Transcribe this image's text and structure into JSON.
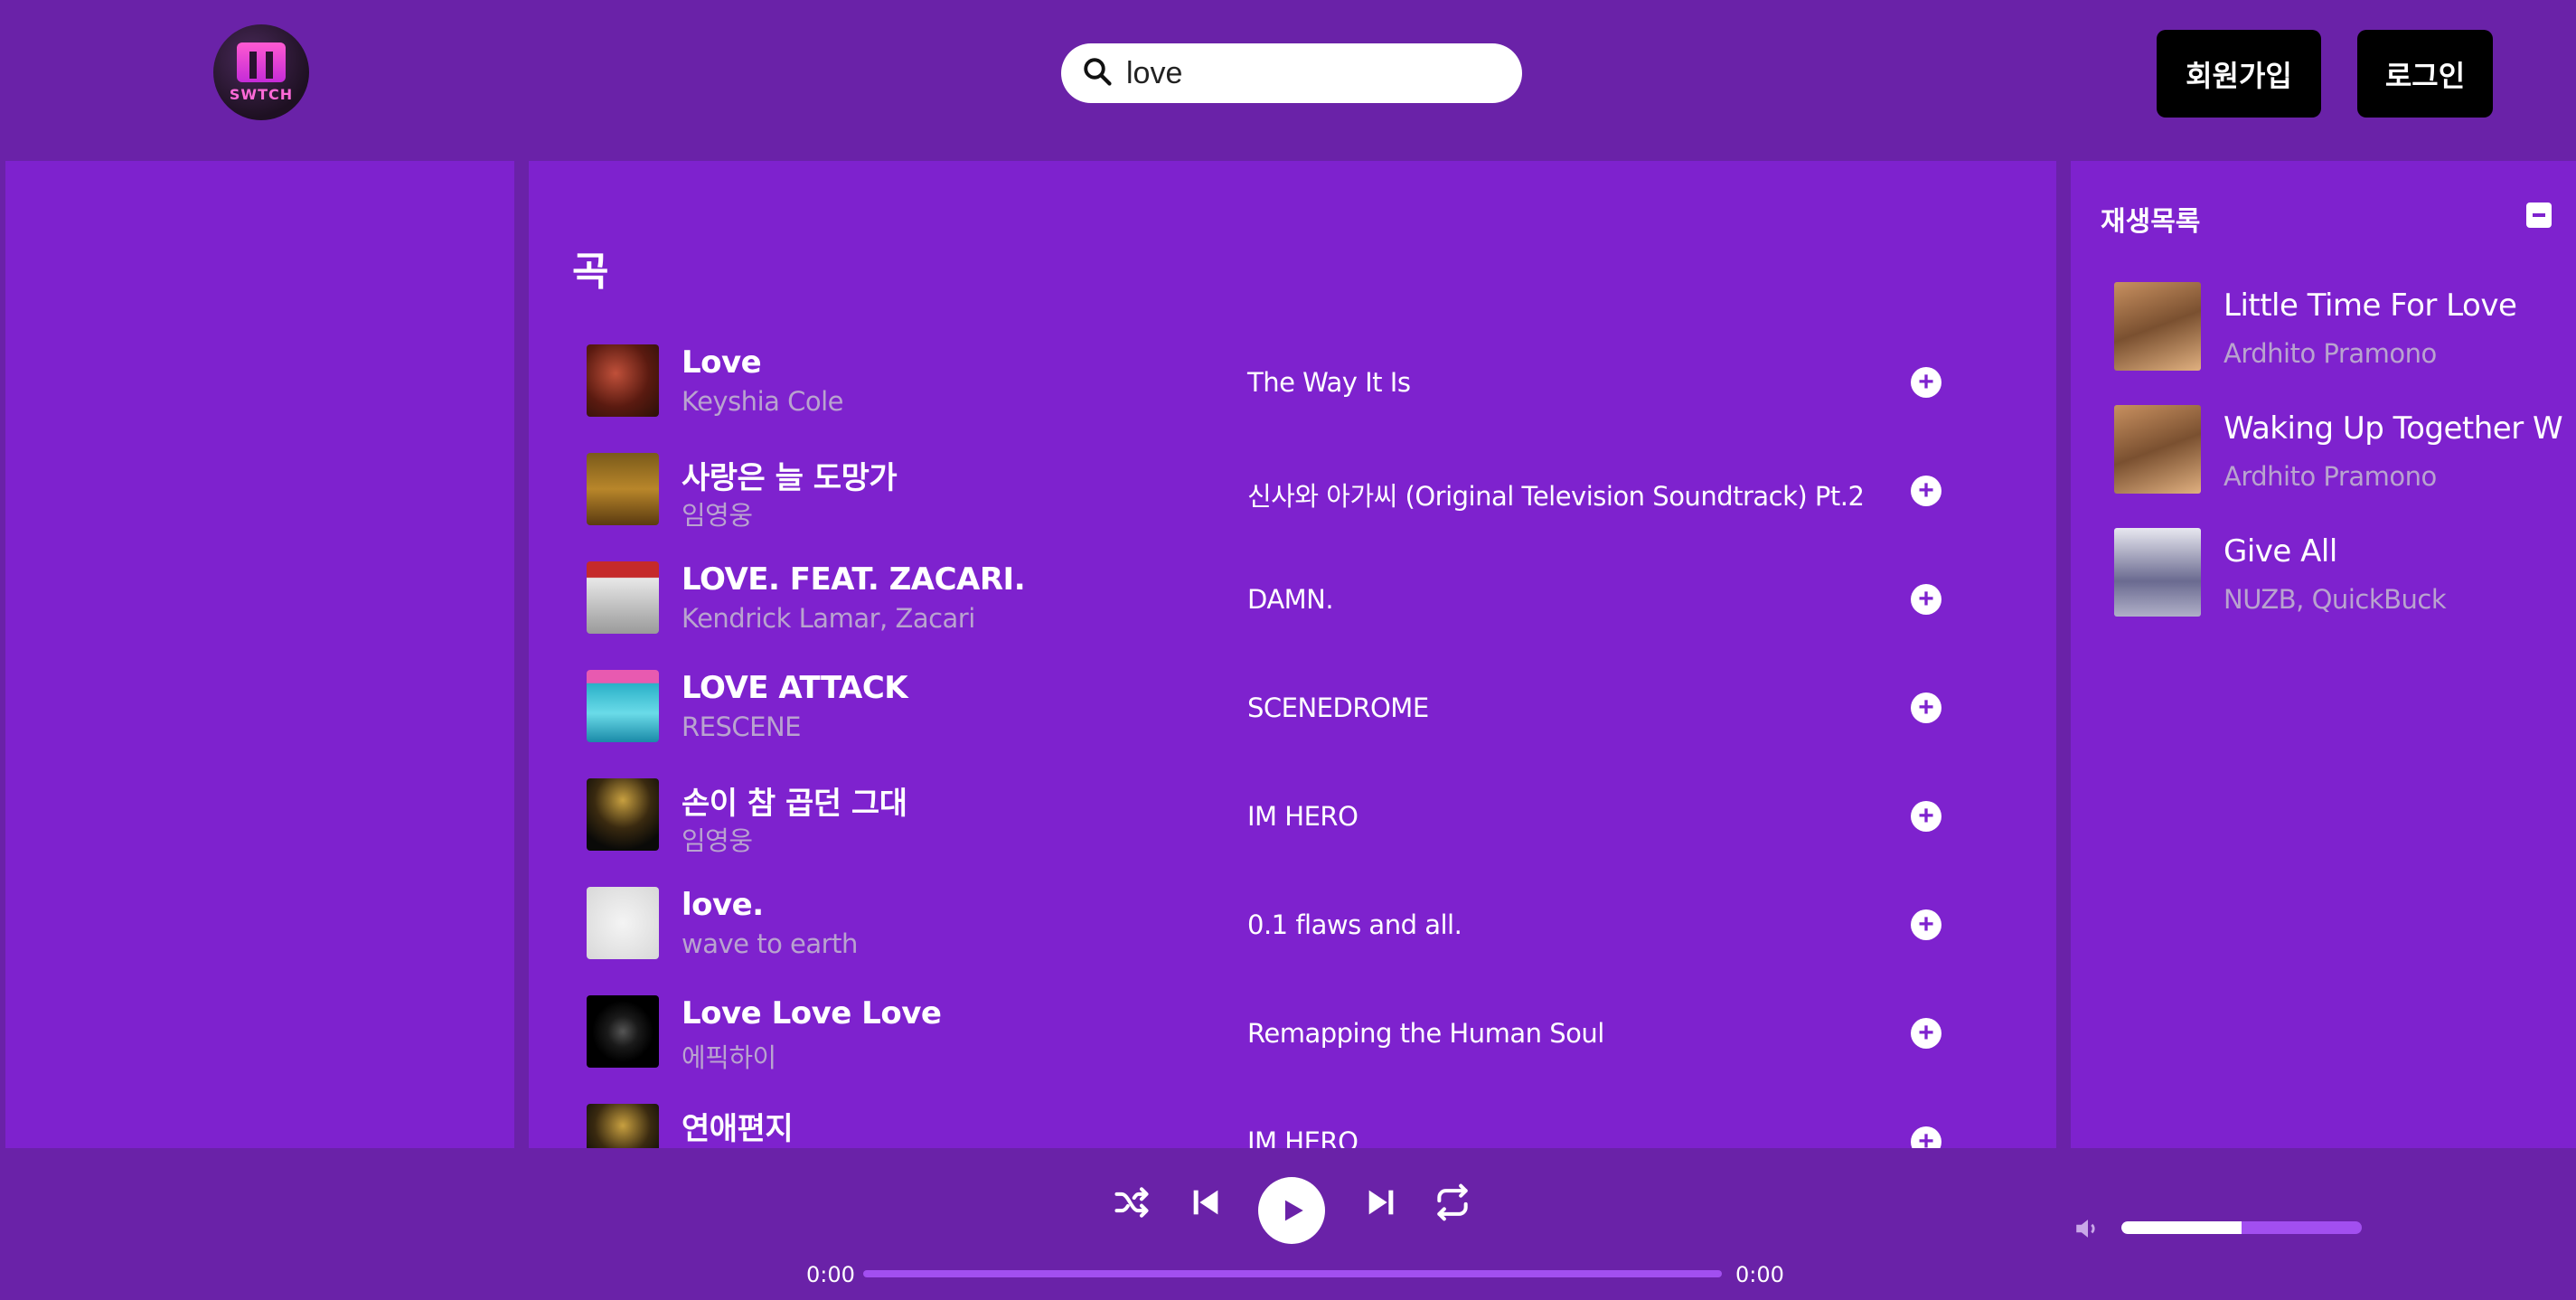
{
  "header": {
    "logo_text": "SWTCH",
    "search_value": "love",
    "signup_label": "회원가입",
    "login_label": "로그인"
  },
  "main": {
    "section_title": "곡",
    "songs": [
      {
        "title": "Love",
        "artist": "Keyshia Cole",
        "album": "The Way It Is"
      },
      {
        "title": "사랑은 늘 도망가",
        "artist": "임영웅",
        "album": "신사와 아가씨 (Original Television Soundtrack) Pt.2"
      },
      {
        "title": "LOVE. FEAT. ZACARI.",
        "artist": "Kendrick Lamar, Zacari",
        "album": "DAMN."
      },
      {
        "title": "LOVE ATTACK",
        "artist": "RESCENE",
        "album": "SCENEDROME"
      },
      {
        "title": "손이 참 곱던 그대",
        "artist": "임영웅",
        "album": "IM HERO"
      },
      {
        "title": "love.",
        "artist": "wave to earth",
        "album": "0.1 flaws and all."
      },
      {
        "title": "Love Love Love",
        "artist": "에픽하이",
        "album": "Remapping the Human Soul"
      },
      {
        "title": "연애편지",
        "artist": "",
        "album": "IM HERO"
      }
    ]
  },
  "playlist": {
    "title": "재생목록",
    "items": [
      {
        "title": "Little Time For Love",
        "artist": "Ardhito Pramono"
      },
      {
        "title": "Waking Up Together W",
        "artist": "Ardhito Pramono"
      },
      {
        "title": "Give All",
        "artist": "NUZB, QuickBuck"
      }
    ]
  },
  "player": {
    "current_time": "0:00",
    "total_time": "0:00",
    "progress": 0,
    "volume": 0.5
  },
  "colors": {
    "background": "#6a22a8",
    "panel": "#7e22ce",
    "accent": "#a24ff0",
    "muted_text": "#b9a3cf"
  }
}
